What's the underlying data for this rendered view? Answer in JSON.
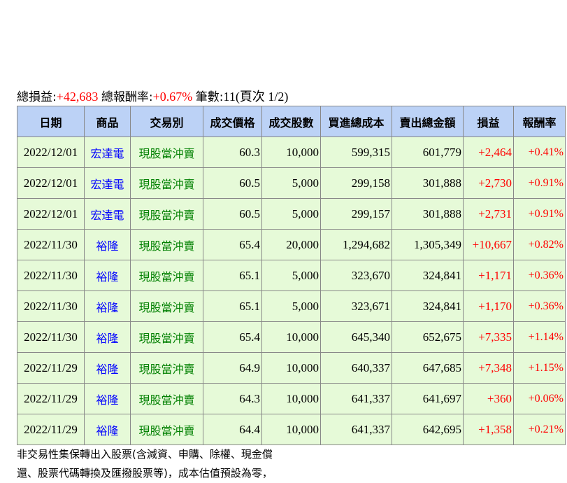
{
  "summary": {
    "total_pl_label": "總損益:",
    "total_pl": "+42,683",
    "total_return_label": "總報酬率:",
    "total_return": "+0.67%",
    "count_label": "筆數:",
    "count": "11",
    "page_info": "(頁次 1/2)"
  },
  "table": {
    "headers": [
      "日期",
      "商品",
      "交易別",
      "成交價格",
      "成交股數",
      "買進總成本",
      "賣出總金額",
      "損益",
      "報酬率"
    ],
    "rows": [
      [
        "2022/12/01",
        "宏達電",
        "現股當沖賣",
        "60.3",
        "10,000",
        "599,315",
        "601,779",
        "+2,464",
        "+0.41%"
      ],
      [
        "2022/12/01",
        "宏達電",
        "現股當沖賣",
        "60.5",
        "5,000",
        "299,158",
        "301,888",
        "+2,730",
        "+0.91%"
      ],
      [
        "2022/12/01",
        "宏達電",
        "現股當沖賣",
        "60.5",
        "5,000",
        "299,157",
        "301,888",
        "+2,731",
        "+0.91%"
      ],
      [
        "2022/11/30",
        "裕隆",
        "現股當沖賣",
        "65.4",
        "20,000",
        "1,294,682",
        "1,305,349",
        "+10,667",
        "+0.82%"
      ],
      [
        "2022/11/30",
        "裕隆",
        "現股當沖賣",
        "65.1",
        "5,000",
        "323,670",
        "324,841",
        "+1,171",
        "+0.36%"
      ],
      [
        "2022/11/30",
        "裕隆",
        "現股當沖賣",
        "65.1",
        "5,000",
        "323,671",
        "324,841",
        "+1,170",
        "+0.36%"
      ],
      [
        "2022/11/30",
        "裕隆",
        "現股當沖賣",
        "65.4",
        "10,000",
        "645,340",
        "652,675",
        "+7,335",
        "+1.14%"
      ],
      [
        "2022/11/29",
        "裕隆",
        "現股當沖賣",
        "64.9",
        "10,000",
        "640,337",
        "647,685",
        "+7,348",
        "+1.15%"
      ],
      [
        "2022/11/29",
        "裕隆",
        "現股當沖賣",
        "64.3",
        "10,000",
        "641,337",
        "641,697",
        "+360",
        "+0.06%"
      ],
      [
        "2022/11/29",
        "裕隆",
        "現股當沖賣",
        "64.4",
        "10,000",
        "641,337",
        "642,695",
        "+1,358",
        "+0.21%"
      ]
    ]
  },
  "note": {
    "line1": "非交易性集保轉出入股票(含減資、申購、除權、現金償",
    "line2": "還、股票代碼轉換及匯撥股票等)，成本估值預設為零，"
  },
  "colors": {
    "header_bg": "#bcd2f6",
    "row_bg": "#e6fad8",
    "profit": "#ff0000",
    "product": "#0000ff",
    "type": "#008000"
  }
}
